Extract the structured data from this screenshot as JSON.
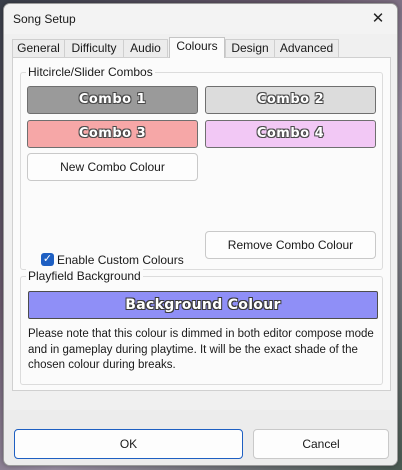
{
  "window": {
    "title": "Song Setup",
    "close_glyph": "✕"
  },
  "tabs": [
    {
      "label": "General",
      "active": false
    },
    {
      "label": "Difficulty",
      "active": false
    },
    {
      "label": "Audio",
      "active": false
    },
    {
      "label": "Colours",
      "active": true
    },
    {
      "label": "Design",
      "active": false
    },
    {
      "label": "Advanced",
      "active": false
    }
  ],
  "combos_group": {
    "label": "Hitcircle/Slider Combos",
    "combos": [
      {
        "label": "Combo 1",
        "color": "#9a9a9a"
      },
      {
        "label": "Combo 2",
        "color": "#dcdcdc"
      },
      {
        "label": "Combo 3",
        "color": "#f6a7a7"
      },
      {
        "label": "Combo 4",
        "color": "#f2c8f5"
      }
    ],
    "new_combo_label": "New Combo Colour",
    "enable_custom_label": "Enable Custom Colours",
    "enable_custom_checked": true,
    "remove_combo_label": "Remove Combo Colour"
  },
  "playfield_group": {
    "label": "Playfield Background",
    "background_button_label": "Background Colour",
    "background_color": "#8f8ff7",
    "note": "Please note that this colour is dimmed in both editor compose mode and in gameplay during playtime.  It will be the exact shade of the chosen colour during breaks."
  },
  "footer": {
    "ok_label": "OK",
    "cancel_label": "Cancel"
  }
}
